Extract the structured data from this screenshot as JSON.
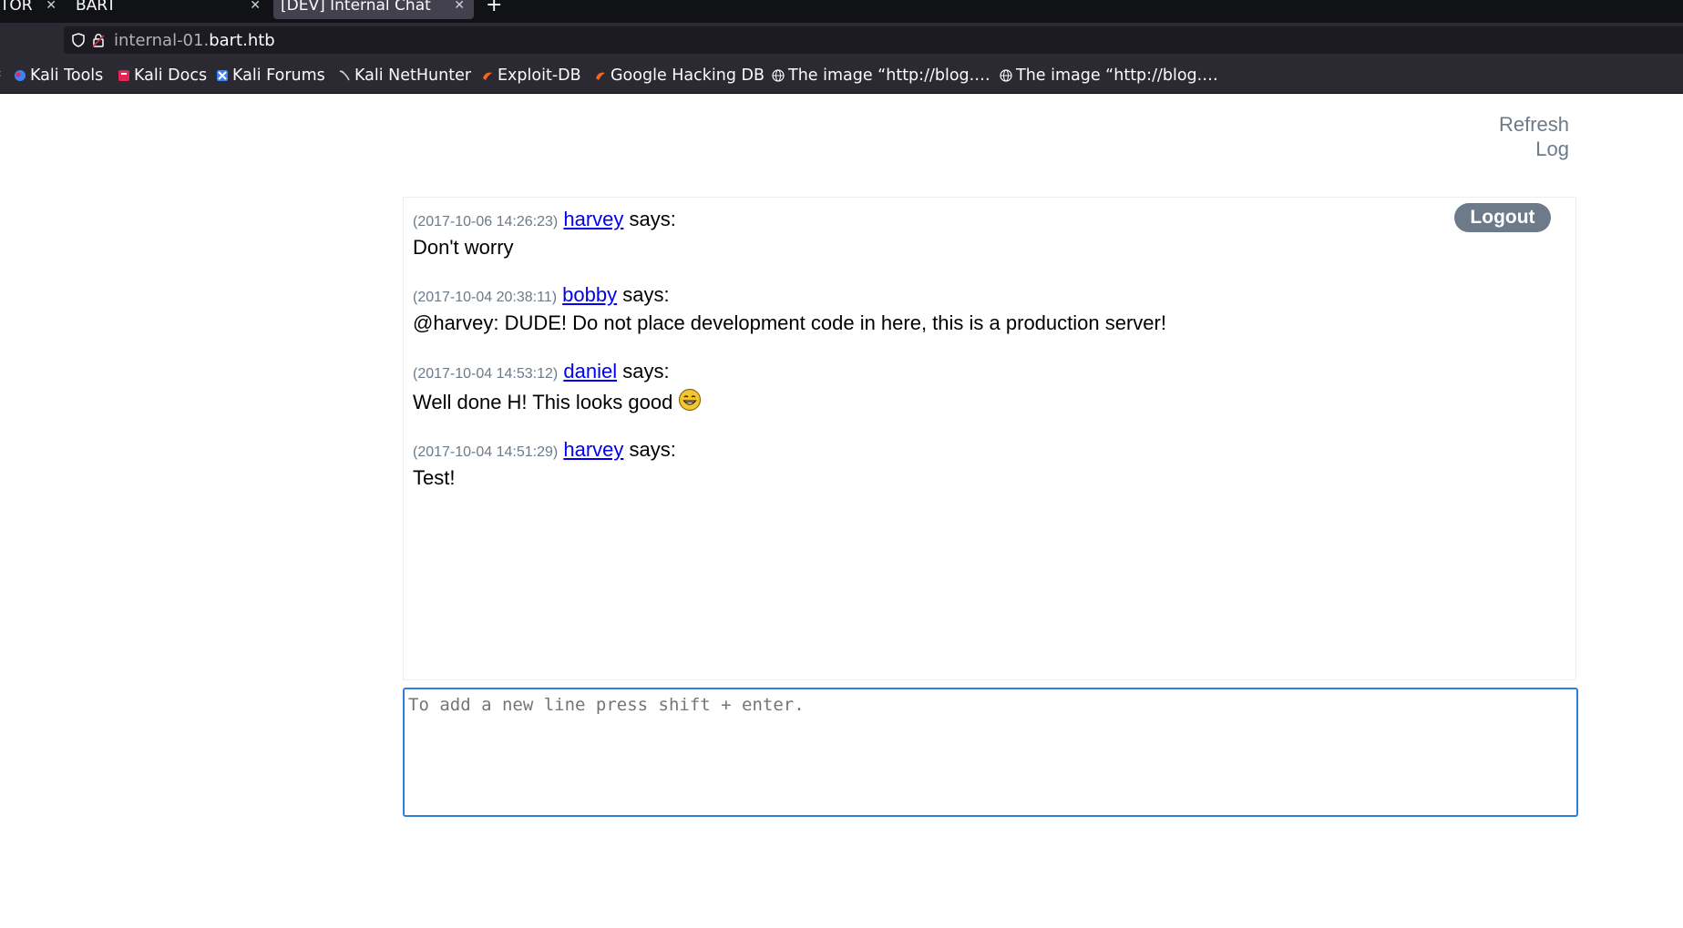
{
  "browser": {
    "tabs": [
      {
        "label": "TOR"
      },
      {
        "label": "BART"
      },
      {
        "label": "[DEV] Internal Chat"
      }
    ],
    "new_tab": "+",
    "url": {
      "prefix": "internal-01.",
      "domain": "bart.htb"
    },
    "bookmarks": [
      {
        "label": "Kali Tools",
        "icon": "kali-tools-icon"
      },
      {
        "label": "Kali Docs",
        "icon": "kali-docs-icon"
      },
      {
        "label": "Kali Forums",
        "icon": "kali-forums-icon"
      },
      {
        "label": "Kali NetHunter",
        "icon": "kali-nethunter-icon"
      },
      {
        "label": "Exploit-DB",
        "icon": "exploit-db-icon"
      },
      {
        "label": "Google Hacking DB",
        "icon": "ghdb-icon"
      },
      {
        "label": "The image “http://blog.…",
        "icon": "globe-icon"
      },
      {
        "label": "The image “http://blog.…",
        "icon": "globe-icon"
      }
    ]
  },
  "header": {
    "refresh_log": "Refresh Log",
    "logout": "Logout"
  },
  "messages": [
    {
      "time": "(2017-10-06 14:26:23)",
      "user": "harvey",
      "says": "says:",
      "text": "Don't worry"
    },
    {
      "time": "(2017-10-04 20:38:11)",
      "user": "bobby",
      "says": "says:",
      "text": "@harvey: DUDE! Do not place development code in here, this is a production server!"
    },
    {
      "time": "(2017-10-04 14:53:12)",
      "user": "daniel",
      "says": "says:",
      "text": "Well done H! This looks good",
      "emoji": "grin-emoji"
    },
    {
      "time": "(2017-10-04 14:51:29)",
      "user": "harvey",
      "says": "says:",
      "text": "Test!"
    }
  ],
  "input": {
    "placeholder": "To add a new line press shift + enter.",
    "value": ""
  },
  "colors": {
    "accent": "#6c7a89",
    "link": "#0000ee",
    "focus": "#2e7fd9"
  }
}
